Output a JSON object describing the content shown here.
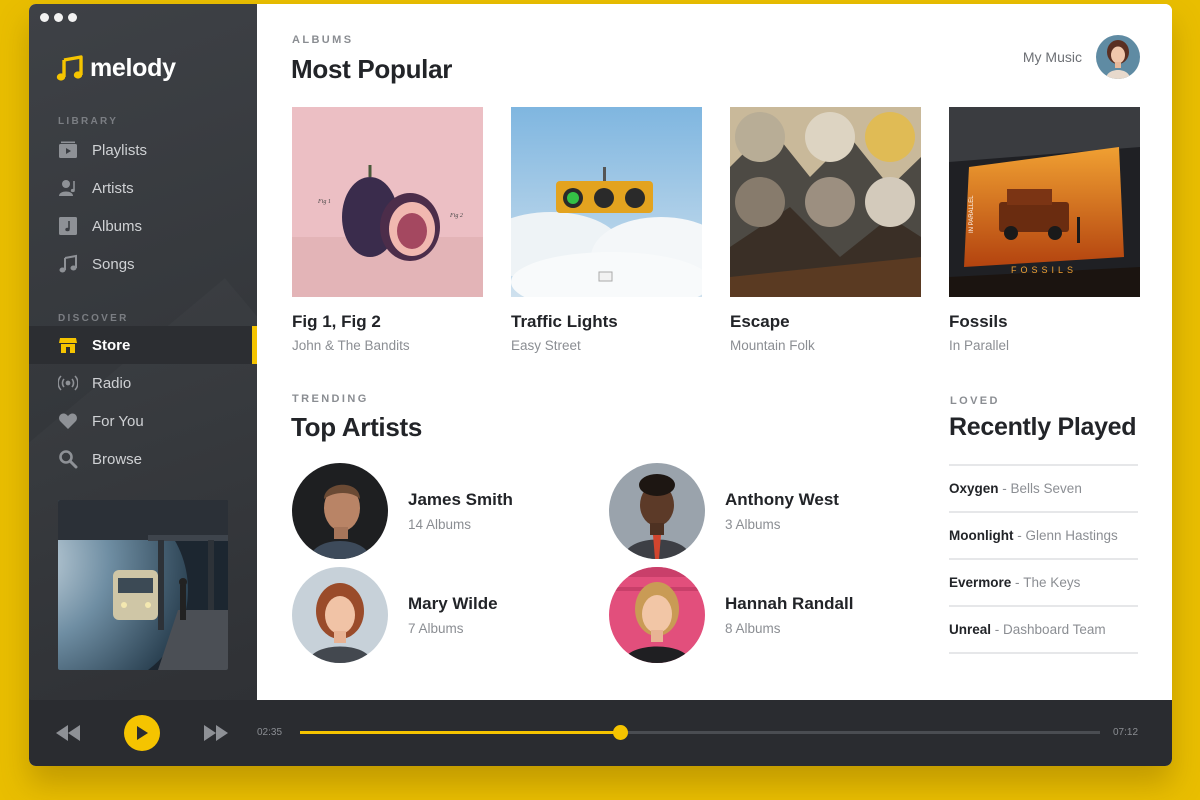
{
  "app": {
    "name": "melody",
    "brand_color": "#f5c400"
  },
  "sidebar": {
    "library_label": "LIBRARY",
    "library_items": [
      {
        "label": "Playlists",
        "icon": "playlist-icon"
      },
      {
        "label": "Artists",
        "icon": "artist-icon"
      },
      {
        "label": "Albums",
        "icon": "album-icon"
      },
      {
        "label": "Songs",
        "icon": "music-note-icon"
      }
    ],
    "discover_label": "DISCOVER",
    "discover_items": [
      {
        "label": "Store",
        "icon": "store-icon",
        "active": true
      },
      {
        "label": "Radio",
        "icon": "radio-icon"
      },
      {
        "label": "For You",
        "icon": "heart-icon"
      },
      {
        "label": "Browse",
        "icon": "search-icon"
      }
    ]
  },
  "header": {
    "kicker": "ALBUMS",
    "title": "Most Popular",
    "user_label": "My Music"
  },
  "albums": [
    {
      "title": "Fig 1, Fig 2",
      "artist": "John & The Bandits",
      "art_text_1": "Fig 1",
      "art_text_2": "Fig 2"
    },
    {
      "title": "Traffic Lights",
      "artist": "Easy Street"
    },
    {
      "title": "Escape",
      "artist": "Mountain Folk"
    },
    {
      "title": "Fossils",
      "artist": "In Parallel",
      "art_text_1": "IN PARALLEL",
      "art_text_2": "FOSSILS"
    }
  ],
  "trending": {
    "kicker": "TRENDING",
    "title": "Top Artists",
    "artists": [
      {
        "name": "James Smith",
        "count": "14 Albums"
      },
      {
        "name": "Anthony West",
        "count": "3 Albums"
      },
      {
        "name": "Mary Wilde",
        "count": "7 Albums"
      },
      {
        "name": "Hannah Randall",
        "count": "8 Albums"
      }
    ]
  },
  "loved": {
    "kicker": "LOVED",
    "title": "Recently Played",
    "items": [
      {
        "song": "Oxygen",
        "artist": "Bells Seven"
      },
      {
        "song": "Moonlight",
        "artist": "Glenn Hastings"
      },
      {
        "song": "Evermore",
        "artist": "The Keys"
      },
      {
        "song": "Unreal",
        "artist": "Dashboard Team"
      }
    ]
  },
  "player": {
    "elapsed": "02:35",
    "duration": "07:12",
    "progress": 0.4
  }
}
